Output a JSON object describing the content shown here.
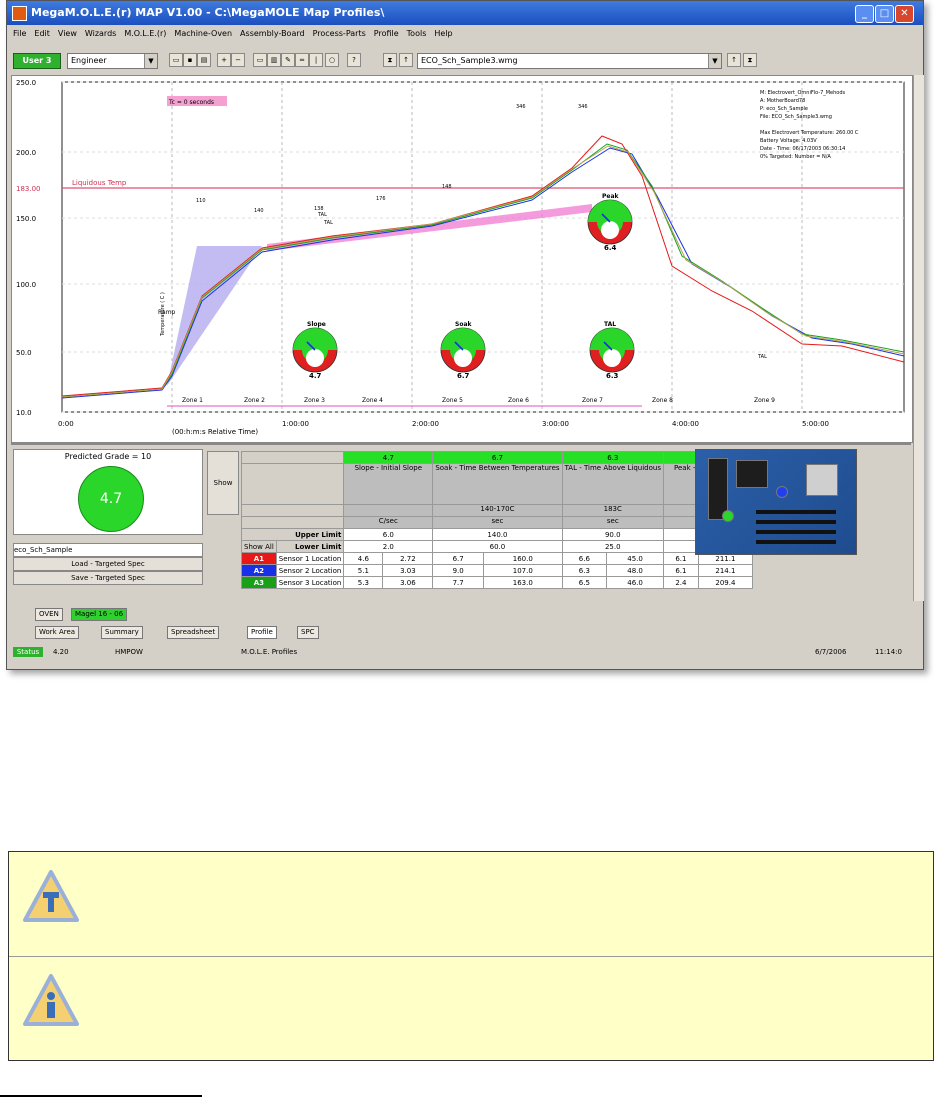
{
  "window": {
    "title": "MegaM.O.L.E.(r) MAP V1.00 - C:\\MegaMOLE Map Profiles\\",
    "controls": [
      "_",
      "□",
      "✕"
    ]
  },
  "menu": [
    "File",
    "Edit",
    "View",
    "Wizards",
    "M.O.L.E.(r)",
    "Machine-Oven",
    "Assembly-Board",
    "Process-Parts",
    "Profile",
    "Tools",
    "Help"
  ],
  "toolbar": {
    "user_button": "User 3",
    "user_combo": "Engineer",
    "file_combo": "ECO_Sch_Sample3.wmg"
  },
  "chart": {
    "y_ticks": [
      "250.0",
      "200.0",
      "183.00",
      "150.0",
      "100.0",
      "50.0",
      "10.0"
    ],
    "x_ticks": [
      "0:00",
      "1:00:00",
      "2:00:00",
      "3:00:00",
      "4:00:00",
      "5:00:00"
    ],
    "x_label": "(00:h:m:s Relative Time)",
    "liquidus_label": "Liquidous Temp",
    "tag_box": "Tc = 0 seconds",
    "zones": [
      "Zone 1",
      "Zone 2",
      "Zone 3",
      "Zone 4",
      "Zone 5",
      "Zone 6",
      "Zone 7",
      "Zone 8",
      "Zone 9"
    ],
    "info_lines": [
      "M: Electrovert_OmniFlo-7_Mehods",
      "A: MotherBoard78",
      "P: eco_Sch_Sample",
      "File: ECO_Sch_Sample3.wmg",
      "",
      "Max Electrovert Temperature: 260.00 C",
      "Battery Voltage: 4.03V",
      "Date - Time: 06/17/2003 06:30:14",
      "0% Targeted: Number = N/A"
    ],
    "gauges": [
      {
        "label": "Peak",
        "value": "6.4"
      },
      {
        "label": "Slope",
        "value": "4.7"
      },
      {
        "label": "Soak",
        "value": "6.7"
      },
      {
        "label": "TAL",
        "value": "6.3"
      }
    ],
    "annotations": [
      "Ramp",
      "Temperature ( C )",
      "TAL",
      "346",
      "346",
      "TAL",
      "110",
      "140",
      "148",
      "176",
      "138",
      "TAL"
    ]
  },
  "predicted": {
    "label": "Predicted Grade = 10",
    "value": "4.7",
    "profile": "eco_Sch_Sample",
    "load_btn": "Load - Targeted Spec",
    "save_btn": "Save - Targeted Spec",
    "show_btn": "Show"
  },
  "spec": {
    "grades": [
      "4.7",
      "6.7",
      "6.3",
      "6.4"
    ],
    "headers": [
      "Slope - Initial Slope",
      "Soak - Time Between Temperatures",
      "TAL - Time Above Liquidous",
      "Peak - Temperature"
    ],
    "sub1": [
      "",
      "140-170C",
      "183C",
      ""
    ],
    "units": [
      "C/sec",
      "sec",
      "sec",
      "C"
    ],
    "upper_label": "Upper Limit",
    "lower_label": "Lower Limit",
    "upper": [
      "6.0",
      "140.0",
      "90.0",
      "235.0"
    ],
    "lower": [
      "2.0",
      "60.0",
      "25.0",
      "200.0"
    ],
    "sensor_all": "Show All",
    "sensors": [
      {
        "tag": "A1",
        "color": "#e81818",
        "name": "Sensor 1 Location",
        "v": [
          "4.6",
          "2.72",
          "6.7",
          "160.0",
          "6.6",
          "45.0",
          "6.1",
          "211.1"
        ]
      },
      {
        "tag": "A2",
        "color": "#1830e8",
        "name": "Sensor 2 Location",
        "v": [
          "5.1",
          "3.03",
          "9.0",
          "107.0",
          "6.3",
          "48.0",
          "6.1",
          "214.1"
        ]
      },
      {
        "tag": "A3",
        "color": "#18a018",
        "name": "Sensor 3 Location",
        "v": [
          "5.3",
          "3.06",
          "7.7",
          "163.0",
          "6.5",
          "46.0",
          "2.4",
          "209.4"
        ]
      }
    ]
  },
  "tabs_row1": [
    "OVEN",
    "Magel 16 - 06"
  ],
  "tabs_row2": [
    "Work Area",
    "Summary",
    "Spreadsheet",
    "Profile",
    "SPC"
  ],
  "status": {
    "left": "Status",
    "value1": "4.20",
    "value2": "HMPOW",
    "center": "M.O.L.E. Profiles",
    "date": "6/7/2006",
    "time": "11:14:0"
  }
}
